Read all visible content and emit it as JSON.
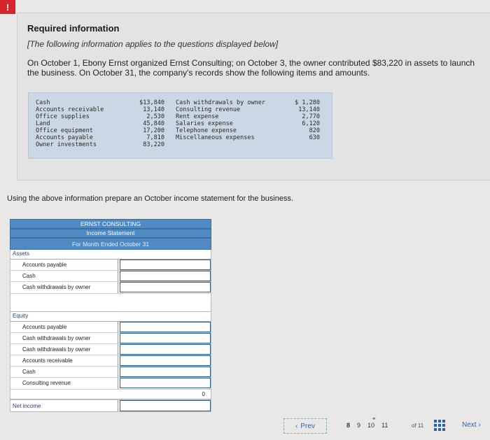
{
  "alert": {
    "glyph": "!"
  },
  "info": {
    "title": "Required information",
    "subtitle": "[The following information applies to the questions displayed below]",
    "paragraph": "On October 1, Ebony Ernst organized Ernst Consulting; on October 3, the owner contributed $83,220 in assets to launch the business. On October 31, the company's records show the following items and amounts.",
    "accounts_left": [
      "Cash",
      "Accounts receivable",
      "Office supplies",
      "Land",
      "Office equipment",
      "Accounts payable",
      "Owner investments"
    ],
    "amounts_left": [
      "$13,840",
      "13,140",
      "2,530",
      "45,840",
      "17,200",
      "7,810",
      "83,220"
    ],
    "accounts_right": [
      "Cash withdrawals by owner",
      "Consulting revenue",
      "Rent expense",
      "Salaries expense",
      "Telephone expense",
      "Miscellaneous expenses"
    ],
    "amounts_right": [
      "$ 1,280",
      "13,140",
      "2,770",
      "6,120",
      "820",
      "630"
    ]
  },
  "instruction": "Using the above information prepare an October income statement for the business.",
  "statement": {
    "company": "ERNST CONSULTING",
    "name": "Income Statement",
    "period": "For Month Ended October 31",
    "section1": {
      "title": "Assets",
      "rows": [
        "Accounts payable",
        "Cash",
        "Cash withdrawals by owner"
      ]
    },
    "section2": {
      "title": "Equity",
      "rows": [
        "Accounts payable",
        "Cash withdrawals by owner",
        "Cash withdrawals by owner",
        "Accounts receivable",
        "Cash",
        "Consulting revenue"
      ]
    },
    "total_value": "0",
    "net_income_label": "Net income"
  },
  "navigation": {
    "prev_label": "Prev",
    "pages": [
      "8",
      "9",
      "10",
      "11"
    ],
    "current_page": "8",
    "of_label": "of 11",
    "next_label": "Next"
  }
}
